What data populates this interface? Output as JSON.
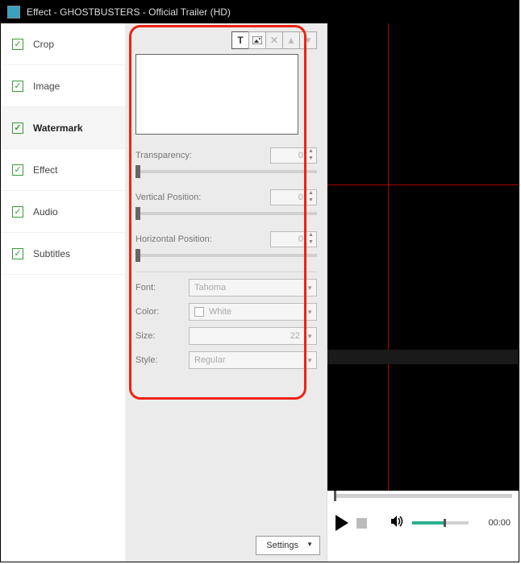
{
  "title": "Effect - GHOSTBUSTERS - Official Trailer (HD)",
  "sidebar": {
    "items": [
      {
        "label": "Crop"
      },
      {
        "label": "Image"
      },
      {
        "label": "Watermark"
      },
      {
        "label": "Effect"
      },
      {
        "label": "Audio"
      },
      {
        "label": "Subtitles"
      }
    ]
  },
  "toolbar": {
    "text_icon": "T",
    "image_icon": "▲",
    "close_icon": "✕",
    "up_icon": "▲",
    "down_icon": "▼"
  },
  "panel": {
    "transparency_label": "Transparency:",
    "transparency_value": "0",
    "vpos_label": "Vertical Position:",
    "vpos_value": "0",
    "hpos_label": "Horizontal Position:",
    "hpos_value": "0",
    "font_label": "Font:",
    "font_value": "Tahoma",
    "color_label": "Color:",
    "color_value": "White",
    "size_label": "Size:",
    "size_value": "22",
    "style_label": "Style:",
    "style_value": "Regular"
  },
  "settings_label": "Settings",
  "player": {
    "time": "00:00"
  }
}
